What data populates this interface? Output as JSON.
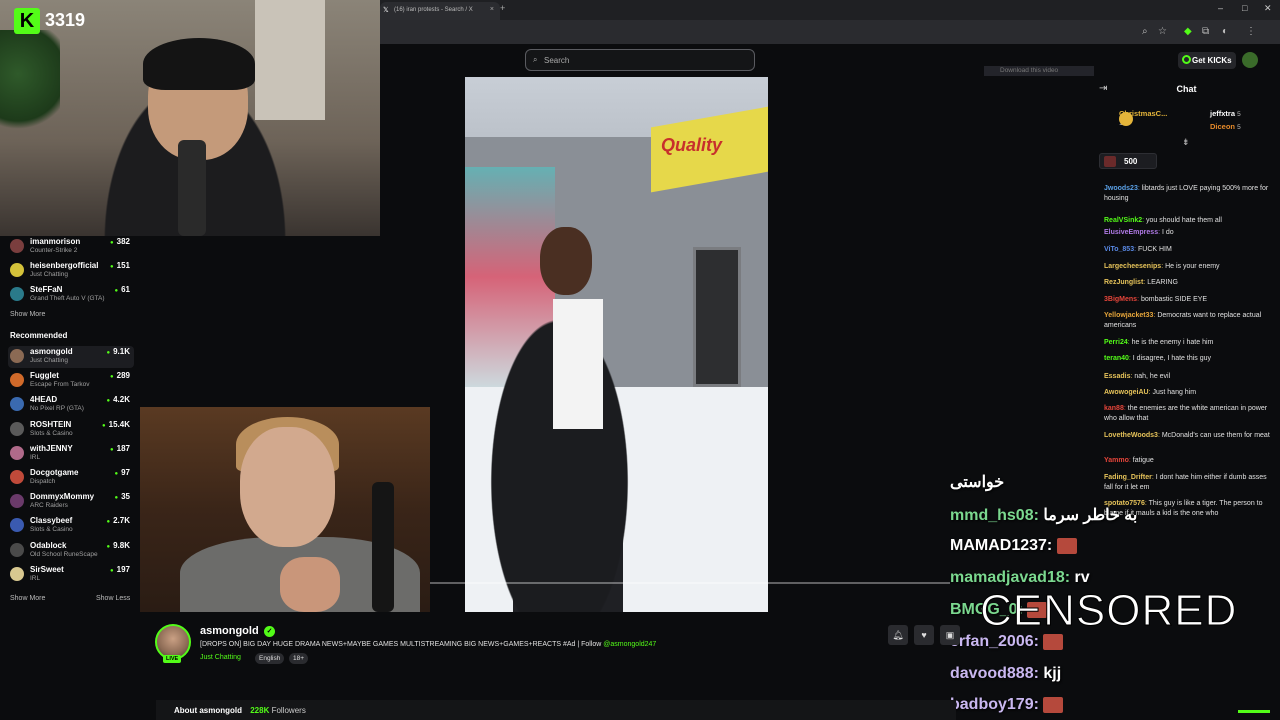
{
  "browser": {
    "tab_title": "(16) iran protests - Search / X",
    "tab_close": "×",
    "new_tab": "+"
  },
  "kick_counter": {
    "logo_letter": "K",
    "count": "3319"
  },
  "topbar": {
    "search_placeholder": "Search",
    "get_kicks_label": "Get KICKs",
    "download_video_label": "Download this video"
  },
  "sidebar": {
    "following_items": [
      {
        "name": "imanmorison",
        "category": "Counter-Strike 2",
        "viewers": "382",
        "color": "#7a3e3e"
      },
      {
        "name": "heisenbergofficial",
        "category": "Just Chatting",
        "viewers": "151",
        "color": "#d4c23a"
      },
      {
        "name": "SteFFaN",
        "category": "Grand Theft Auto V (GTA)",
        "viewers": "61",
        "color": "#2a7a8a"
      }
    ],
    "show_more_1": "Show More",
    "recommended_header": "Recommended",
    "recommended_items": [
      {
        "name": "asmongold",
        "category": "Just Chatting",
        "viewers": "9.1K",
        "color": "#8b6a54"
      },
      {
        "name": "Fugglet",
        "category": "Escape From Tarkov",
        "viewers": "289",
        "color": "#d06a2a"
      },
      {
        "name": "4HEAD",
        "category": "No Pixel RP (GTA)",
        "viewers": "4.2K",
        "color": "#3a6ab0"
      },
      {
        "name": "ROSHTEIN",
        "category": "Slots & Casino",
        "viewers": "15.4K",
        "color": "#5a5a5a"
      },
      {
        "name": "withJENNY",
        "category": "IRL",
        "viewers": "187",
        "color": "#b06a8a"
      },
      {
        "name": "Docgotgame",
        "category": "Dispatch",
        "viewers": "97",
        "color": "#c04a3a"
      },
      {
        "name": "DommyxMommy",
        "category": "ARC Raiders",
        "viewers": "35",
        "color": "#6a3a6a"
      },
      {
        "name": "Classybeef",
        "category": "Slots & Casino",
        "viewers": "2.7K",
        "color": "#3a5ab0"
      },
      {
        "name": "Odablock",
        "category": "Old School RuneScape",
        "viewers": "9.8K",
        "color": "#4a4a4a"
      },
      {
        "name": "SirSweet",
        "category": "IRL",
        "viewers": "197",
        "color": "#d8c890"
      }
    ],
    "show_more_2": "Show More",
    "show_less": "Show Less"
  },
  "chat": {
    "title": "Chat",
    "gifters": [
      {
        "name": "ChristmasC...",
        "count": "15",
        "color": "#e5b53a"
      },
      {
        "name": "jeffxtra",
        "count": "5",
        "color": "#ffffff"
      },
      {
        "name": "Diceon",
        "count": "5",
        "color": "#e58a2a"
      }
    ],
    "pinned_value": "500",
    "messages": [
      {
        "user": "Jwoods23",
        "color": "#5aa0e6",
        "text": "libtards just LOVE paying 500% more for housing"
      },
      {
        "user": "RealVSink2",
        "color": "#53fc18",
        "text": "you should hate them all"
      },
      {
        "user": "ElusiveEmpress",
        "color": "#b07ae6",
        "text": "I do"
      },
      {
        "user": "ViTo_853",
        "color": "#5a8ae6",
        "text": "FUCK HIM"
      },
      {
        "user": "Largecheesenips",
        "color": "#e6c35a",
        "text": "He is your enemy"
      },
      {
        "user": "RezJunglist",
        "color": "#e6c35a",
        "text": "LEARING"
      },
      {
        "user": "3BigMens",
        "color": "#e6453a",
        "text": "bombastic SIDE EYE"
      },
      {
        "user": "Yellowjacket33",
        "color": "#e6a53a",
        "text": "Democrats want to replace actual americans"
      },
      {
        "user": "Perri24",
        "color": "#53fc18",
        "text": "he is the enemy i hate him"
      },
      {
        "user": "teran40",
        "color": "#53fc18",
        "text": "I disagree, I hate this guy"
      },
      {
        "user": "Essadis",
        "color": "#e6c35a",
        "text": "nah, he evil"
      },
      {
        "user": "AwowogeiAU",
        "color": "#e6c35a",
        "text": "Just hang him"
      },
      {
        "user": "kan88",
        "color": "#e6453a",
        "text": "the enemies are the white american in power who allow that"
      },
      {
        "user": "LovetheWoods3",
        "color": "#e6c35a",
        "text": "McDonald's can use them for meat"
      },
      {
        "user": "Yammo",
        "color": "#e6453a",
        "text": "fatigue"
      },
      {
        "user": "Fading_Drifter",
        "color": "#e6c35a",
        "text": "I dont hate him either if dumb asses fall for it let em"
      },
      {
        "user": "spotato7576",
        "color": "#e6c35a",
        "text": "This guy is like a tiger. The person to blame if it mauls a kid is the one who"
      }
    ]
  },
  "overlay_chat": {
    "lines": [
      {
        "user": "",
        "text": "خواستی",
        "color": "#ffffff"
      },
      {
        "user": "mmd_hs08:",
        "text": "به خاطر سرما",
        "color": "#7bd88f"
      },
      {
        "user": "MAMAD1237:",
        "text": "",
        "color": "#ffffff"
      },
      {
        "user": "mamadjavad18:",
        "text": "rv",
        "color": "#7bd88f"
      },
      {
        "user": "BMGG_0:",
        "text": "",
        "color": "#7bd88f"
      },
      {
        "user": "erfan_2006:",
        "text": "",
        "color": "#c9b7f0"
      },
      {
        "user": "davood888:",
        "text": "kjj",
        "color": "#c9b7f0"
      },
      {
        "user": "badboy179:",
        "text": "",
        "color": "#c9b7f0"
      }
    ],
    "censored_label": "CENSORED"
  },
  "stream": {
    "streamer_name": "asmongold",
    "live_badge": "LIVE",
    "title": "[DROPS ON] BIG DAY HUGE DRAMA NEWS+MAYBE GAMES MULTISTREAMING BIG NEWS+GAMES+REACTS #Ad | Follow ",
    "title_handle": "@asmongold247",
    "category": "Just Chatting",
    "tags": [
      "English",
      "18+"
    ],
    "about_label": "About asmongold",
    "followers_count": "228K",
    "followers_label": "Followers"
  },
  "video_sign": "Quality",
  "accent_color": "#53fc18"
}
